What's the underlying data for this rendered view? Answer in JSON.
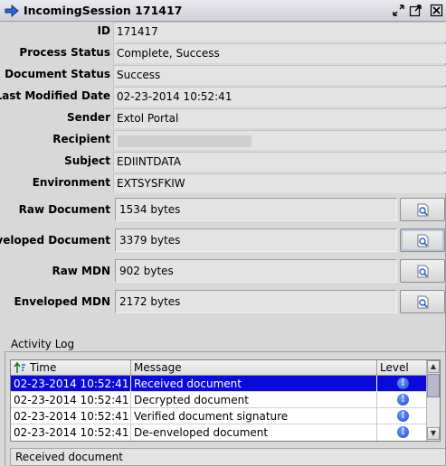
{
  "window": {
    "title": "IncomingSession 171417",
    "title_icon": "arrow-right-icon",
    "controls": [
      "restore-icon",
      "maximize-icon",
      "close-icon"
    ]
  },
  "fields": {
    "id": {
      "label": "ID",
      "value": "171417"
    },
    "process_status": {
      "label": "Process Status",
      "value": "Complete, Success"
    },
    "document_status": {
      "label": "Document Status",
      "value": "Success"
    },
    "last_modified": {
      "label": "Last Modified Date",
      "value": "02-23-2014 10:52:41"
    },
    "sender": {
      "label": "Sender",
      "value": "Extol Portal"
    },
    "recipient": {
      "label": "Recipient",
      "value": ""
    },
    "subject": {
      "label": "Subject",
      "value": "EDIINTDATA"
    },
    "environment": {
      "label": "Environment",
      "value": "EXTSYSFKIW"
    }
  },
  "documents": {
    "raw_document": {
      "label": "Raw Document",
      "value": "1534 bytes"
    },
    "enveloped_document": {
      "label": "Enveloped Document",
      "value": "3379 bytes"
    },
    "raw_mdn": {
      "label": "Raw MDN",
      "value": "902 bytes"
    },
    "enveloped_mdn": {
      "label": "Enveloped MDN",
      "value": "2172 bytes"
    }
  },
  "activity_log": {
    "title": "Activity Log",
    "columns": {
      "time": "Time",
      "message": "Message",
      "level": "Level"
    },
    "rows": [
      {
        "time": "02-23-2014 10:52:41",
        "message": "Received document",
        "level_icon": "info-icon",
        "level_glyph": "!"
      },
      {
        "time": "02-23-2014 10:52:41",
        "message": "Decrypted document",
        "level_icon": "info-icon",
        "level_glyph": "!"
      },
      {
        "time": "02-23-2014 10:52:41",
        "message": "Verified document signature",
        "level_icon": "info-icon",
        "level_glyph": "!"
      },
      {
        "time": "02-23-2014 10:52:41",
        "message": "De-enveloped document",
        "level_icon": "info-icon",
        "level_glyph": "!"
      }
    ],
    "selected_row": 0,
    "detail": "Received document"
  },
  "colors": {
    "selection": "#0a0adc",
    "background": "#d8d8d8"
  }
}
